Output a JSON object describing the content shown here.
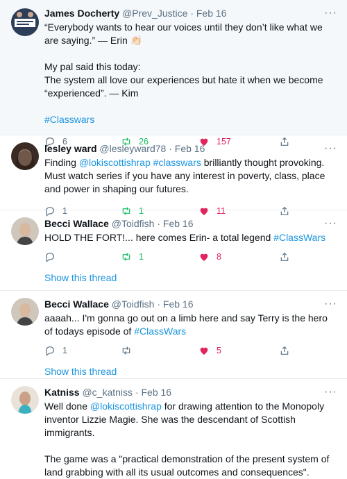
{
  "tweets": [
    {
      "name": "James Docherty",
      "handle": "@Prev_Justice",
      "date": "Feb 16",
      "text_html": "“Everybody wants to hear our voices until they don’t like what we are saying.” — Erin 👏🏻\n\nMy pal said this today:\nThe system all love our experiences but hate it when we become “experienced”. — Kim\n\n<span class=\"link\">#Classwars</span>",
      "replies": "6",
      "retweets": "26",
      "likes": "157"
    },
    {
      "name": "lesley ward",
      "handle": "@lesleyward78",
      "date": "Feb 16",
      "text_html": "Finding <span class=\"link\">@lokiscottishrap</span> <span class=\"link\">#classwars</span> brilliantly thought provoking. Must watch series if you have any interest in poverty, class, place and power in shaping our futures.",
      "replies": "1",
      "retweets": "1",
      "likes": "11"
    },
    {
      "name": "Becci Wallace",
      "handle": "@Toidfish",
      "date": "Feb 16",
      "text_html": "HOLD THE FORT!... here comes Erin- a total legend <span class=\"link\">#ClassWars</span>",
      "replies": "",
      "retweets": "1",
      "likes": "8",
      "thread": "Show this thread"
    },
    {
      "name": "Becci Wallace",
      "handle": "@Toidfish",
      "date": "Feb 16",
      "text_html": "aaaah... I'm gonna go out on a limb here and say Terry is the hero of todays episode of <span class=\"link\">#ClassWars</span>",
      "replies": "1",
      "retweets": "",
      "likes": "5",
      "thread": "Show this thread"
    },
    {
      "name": "Katniss",
      "handle": "@c_katniss",
      "date": "Feb 16",
      "text_html": "Well done <span class=\"link\">@lokiscottishrap</span> for drawing attention to the Monopoly inventor Lizzie Magie. She was the descendant of Scottish immigrants.\n\nThe game was a \"practical demonstration of the present system of land grabbing with all its usual outcomes and consequences\"."
    }
  ],
  "dot": "·",
  "more": "···",
  "colors": {
    "link": "#1b95e0",
    "retweet": "#17bf63",
    "like": "#e0245e",
    "muted": "#5b7083"
  },
  "icons": [
    "reply-icon",
    "retweet-icon",
    "like-icon",
    "share-icon",
    "more-icon"
  ]
}
